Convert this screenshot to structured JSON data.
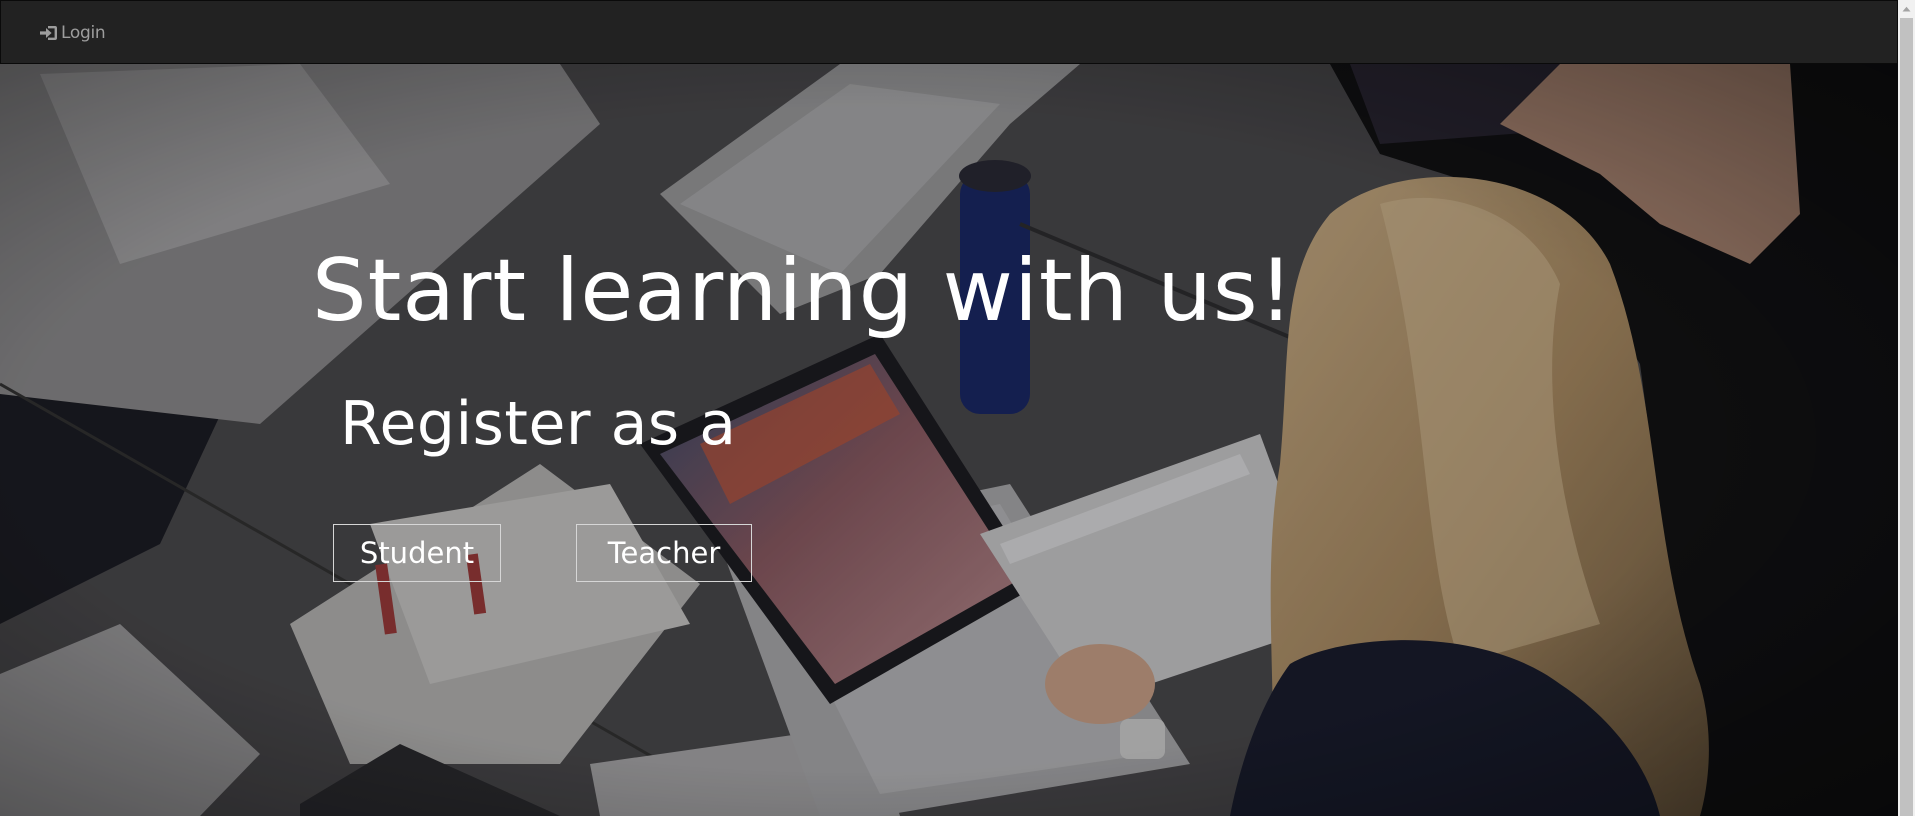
{
  "navbar": {
    "login_label": "Login",
    "login_icon": "sign-in-icon",
    "background": "#222222",
    "text_color": "#9d9d9d"
  },
  "hero": {
    "headline": "Start learning with us!",
    "subheadline": "Register as a",
    "buttons": {
      "student_label": "Student",
      "teacher_label": "Teacher"
    },
    "text_color": "#ffffff",
    "background_image": "overhead-photo-woman-with-laptop-and-book-on-desk"
  }
}
